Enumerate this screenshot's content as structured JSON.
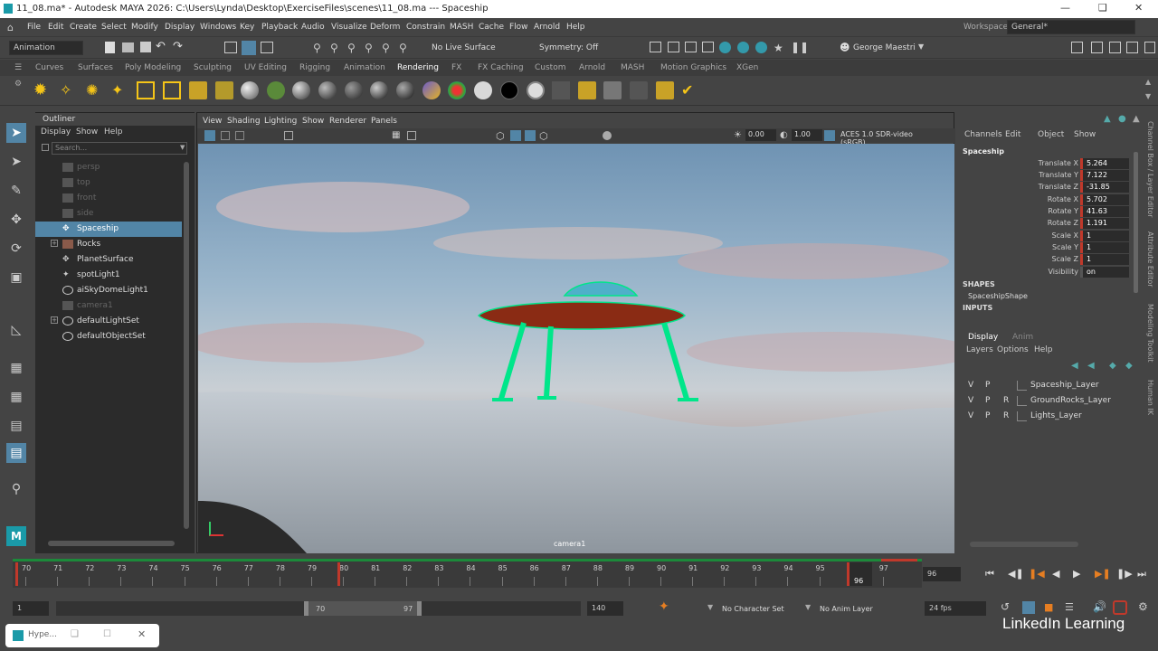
{
  "window": {
    "title": "11_08.ma* - Autodesk MAYA 2026: C:\\Users\\Lynda\\Desktop\\ExerciseFiles\\scenes\\11_08.ma   ---   Spaceship"
  },
  "menubar": {
    "items": [
      "File",
      "Edit",
      "Create",
      "Select",
      "Modify",
      "Display",
      "Windows",
      "Key",
      "Playback",
      "Audio",
      "Visualize",
      "Deform",
      "Constrain",
      "MASH",
      "Cache",
      "Flow",
      "Arnold",
      "Help"
    ],
    "workspace_label": "Workspace:",
    "workspace_value": "General*"
  },
  "statusline": {
    "menuset": "Animation",
    "live_surface": "No Live Surface",
    "symmetry": "Symmetry: Off",
    "user": "George Maestri"
  },
  "shelf": {
    "tabs": [
      "Curves",
      "Surfaces",
      "Poly Modeling",
      "Sculpting",
      "UV Editing",
      "Rigging",
      "Animation",
      "Rendering",
      "FX",
      "FX Caching",
      "Custom",
      "Arnold",
      "MASH",
      "Motion Graphics",
      "XGen"
    ],
    "active_tab": "Rendering"
  },
  "outliner": {
    "title": "Outliner",
    "menus": [
      "Display",
      "Show",
      "Help"
    ],
    "search_placeholder": "Search...",
    "items": [
      {
        "label": "persp",
        "dim": true
      },
      {
        "label": "top",
        "dim": true
      },
      {
        "label": "front",
        "dim": true
      },
      {
        "label": "side",
        "dim": true
      },
      {
        "label": "Spaceship",
        "selected": true
      },
      {
        "label": "Rocks",
        "expandable": true
      },
      {
        "label": "PlanetSurface"
      },
      {
        "label": "spotLight1"
      },
      {
        "label": "aiSkyDomeLight1"
      },
      {
        "label": "camera1",
        "dim": true
      },
      {
        "label": "defaultLightSet",
        "expandable": true
      },
      {
        "label": "defaultObjectSet"
      }
    ]
  },
  "viewport": {
    "menus": [
      "View",
      "Shading",
      "Lighting",
      "Show",
      "Renderer",
      "Panels"
    ],
    "near_value": "0.00",
    "far_value": "1.00",
    "colorspace": "ACES 1.0 SDR-video (sRGB)",
    "camera_label": "camera1"
  },
  "channelbox": {
    "menus": [
      "Channels",
      "Edit",
      "Object",
      "Show"
    ],
    "object_name": "Spaceship",
    "attributes": [
      {
        "name": "Translate X",
        "value": "5.264"
      },
      {
        "name": "Translate Y",
        "value": "7.122"
      },
      {
        "name": "Translate Z",
        "value": "-31.85"
      },
      {
        "name": "Rotate X",
        "value": "5.702"
      },
      {
        "name": "Rotate Y",
        "value": "41.63"
      },
      {
        "name": "Rotate Z",
        "value": "1.191"
      },
      {
        "name": "Scale X",
        "value": "1"
      },
      {
        "name": "Scale Y",
        "value": "1"
      },
      {
        "name": "Scale Z",
        "value": "1"
      },
      {
        "name": "Visibility",
        "value": "on"
      }
    ],
    "shapes_label": "SHAPES",
    "shape_name": "SpaceshipShape",
    "inputs_label": "INPUTS"
  },
  "layer_editor": {
    "tabs": [
      "Display",
      "Anim"
    ],
    "menus": [
      "Layers",
      "Options",
      "Help"
    ],
    "layers": [
      {
        "v": "V",
        "p": "P",
        "r": "",
        "name": "Spaceship_Layer"
      },
      {
        "v": "V",
        "p": "P",
        "r": "R",
        "name": "GroundRocks_Layer"
      },
      {
        "v": "V",
        "p": "P",
        "r": "R",
        "name": "Lights_Layer"
      }
    ]
  },
  "sidetabs": [
    "Channel Box / Layer Editor",
    "Attribute Editor",
    "Modeling Toolkit",
    "Human IK"
  ],
  "timeslider": {
    "ticks": [
      "70",
      "71",
      "72",
      "73",
      "74",
      "75",
      "76",
      "77",
      "78",
      "79",
      "80",
      "81",
      "82",
      "83",
      "84",
      "85",
      "86",
      "87",
      "88",
      "89",
      "90",
      "91",
      "92",
      "93",
      "94",
      "95",
      "96",
      "97"
    ],
    "current_frame": "96",
    "current_frame_marker": "96"
  },
  "rangeslider": {
    "start": "1",
    "range_start": "70",
    "range_end": "97",
    "end": "140",
    "character_set": "No Character Set",
    "anim_layer": "No Anim Layer",
    "fps": "24 fps"
  },
  "taskbar": {
    "app_label": "Hype..."
  },
  "watermark": "LinkedIn Learning",
  "colors": {
    "selection": "#5285a6",
    "keyed": "#c0392b",
    "wireframe": "#00e68a"
  }
}
